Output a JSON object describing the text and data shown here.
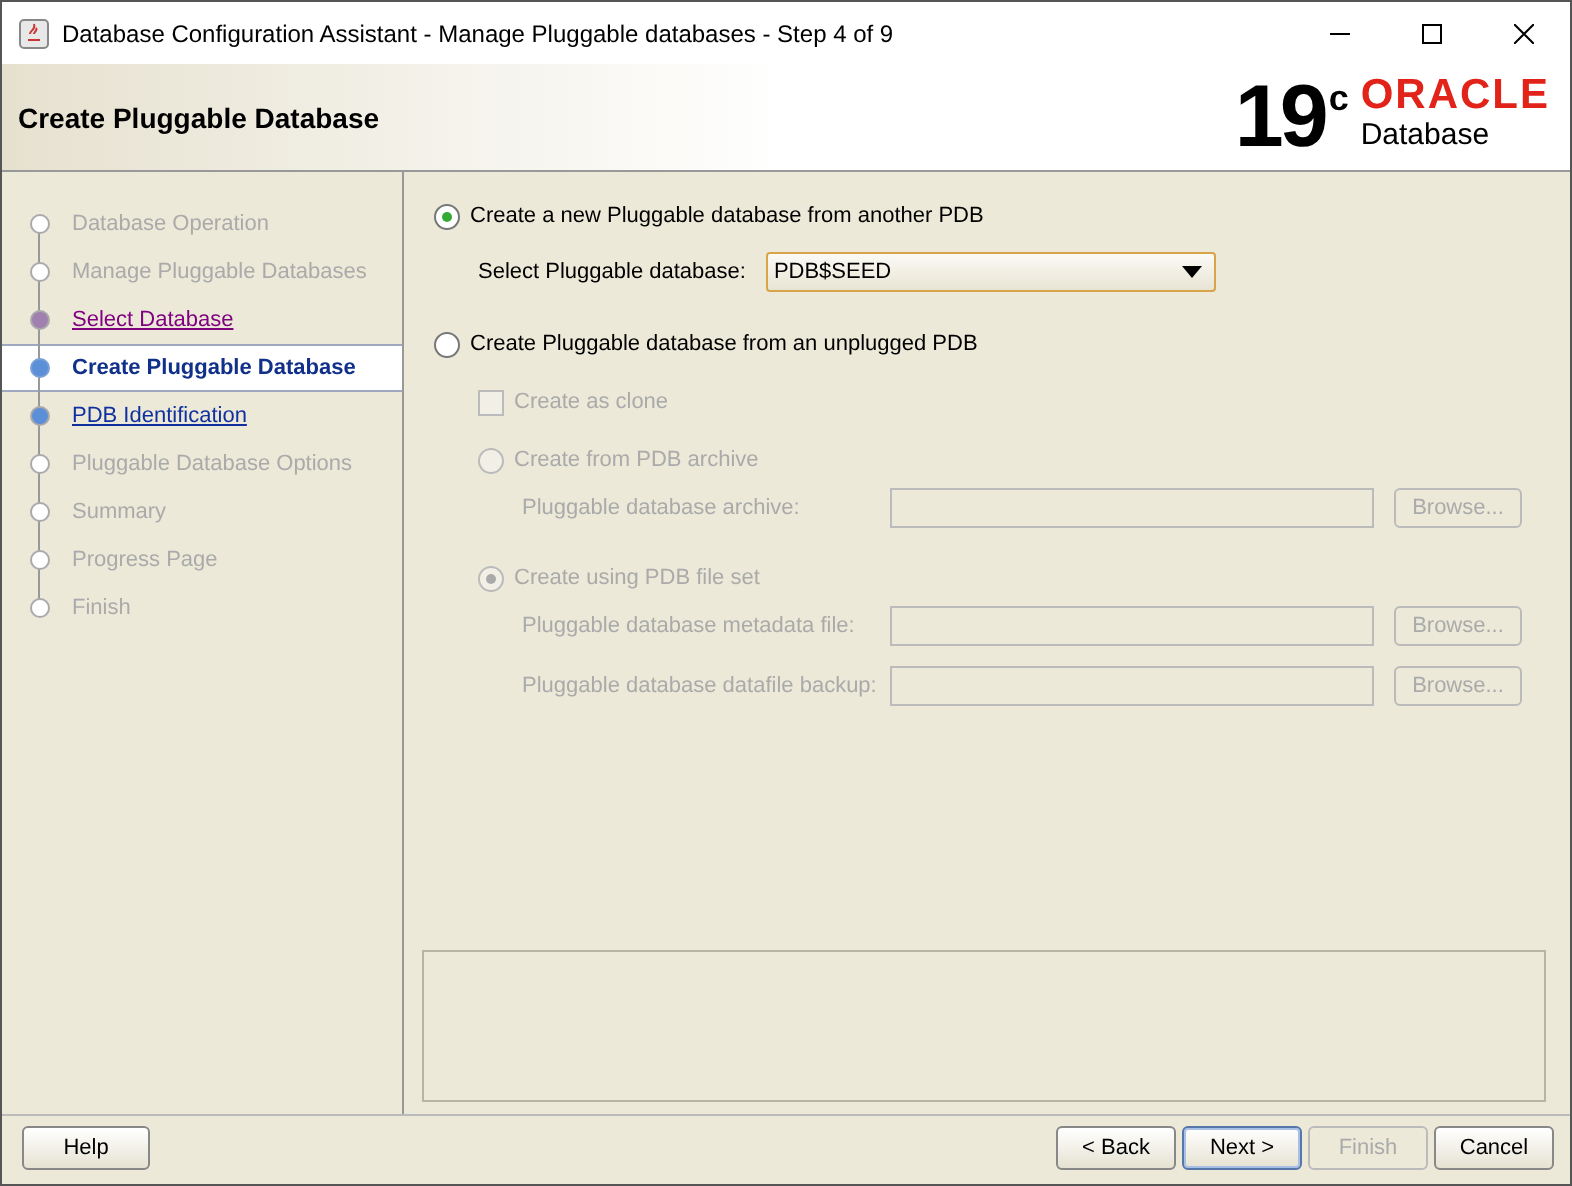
{
  "window": {
    "title": "Database Configuration Assistant - Manage Pluggable databases - Step 4 of 9"
  },
  "header": {
    "title": "Create Pluggable Database",
    "logo_version": "19",
    "logo_suffix": "c",
    "logo_brand": "ORACLE",
    "logo_product": "Database"
  },
  "steps": [
    {
      "label": "Database Operation",
      "kind": "pending"
    },
    {
      "label": "Manage Pluggable Databases",
      "kind": "pending"
    },
    {
      "label": "Select Database",
      "kind": "visited"
    },
    {
      "label": "Create Pluggable Database",
      "kind": "current"
    },
    {
      "label": "PDB Identification",
      "kind": "link"
    },
    {
      "label": "Pluggable Database Options",
      "kind": "pending"
    },
    {
      "label": "Summary",
      "kind": "pending"
    },
    {
      "label": "Progress Page",
      "kind": "pending"
    },
    {
      "label": "Finish",
      "kind": "pending"
    }
  ],
  "options": [
    {
      "label": "Create a new Pluggable database from another PDB",
      "selected": true,
      "disabled": false
    },
    {
      "label": "Create Pluggable database from an unplugged PDB",
      "selected": false,
      "disabled": false
    }
  ],
  "select_pdb": {
    "label": "Select Pluggable database:",
    "value": "PDB$SEED"
  },
  "clone": {
    "label": "Create as clone",
    "checked": false,
    "disabled": true
  },
  "sources": [
    {
      "label": "Create from PDB archive",
      "selected": false,
      "disabled": true,
      "fields": [
        {
          "label": "Pluggable database archive:",
          "button": "Browse..."
        }
      ]
    },
    {
      "label": "Create using PDB file set",
      "selected": true,
      "disabled": true,
      "fields": [
        {
          "label": "Pluggable database metadata file:",
          "button": "Browse..."
        },
        {
          "label": "Pluggable database datafile backup:",
          "button": "Browse..."
        }
      ]
    }
  ],
  "buttons": {
    "help": "Help",
    "nav": [
      {
        "label": "< Back",
        "disabled": false,
        "default": false
      },
      {
        "label": "Next >",
        "disabled": false,
        "default": true
      },
      {
        "label": "Finish",
        "disabled": true,
        "default": false
      },
      {
        "label": "Cancel",
        "disabled": false,
        "default": false
      }
    ]
  }
}
